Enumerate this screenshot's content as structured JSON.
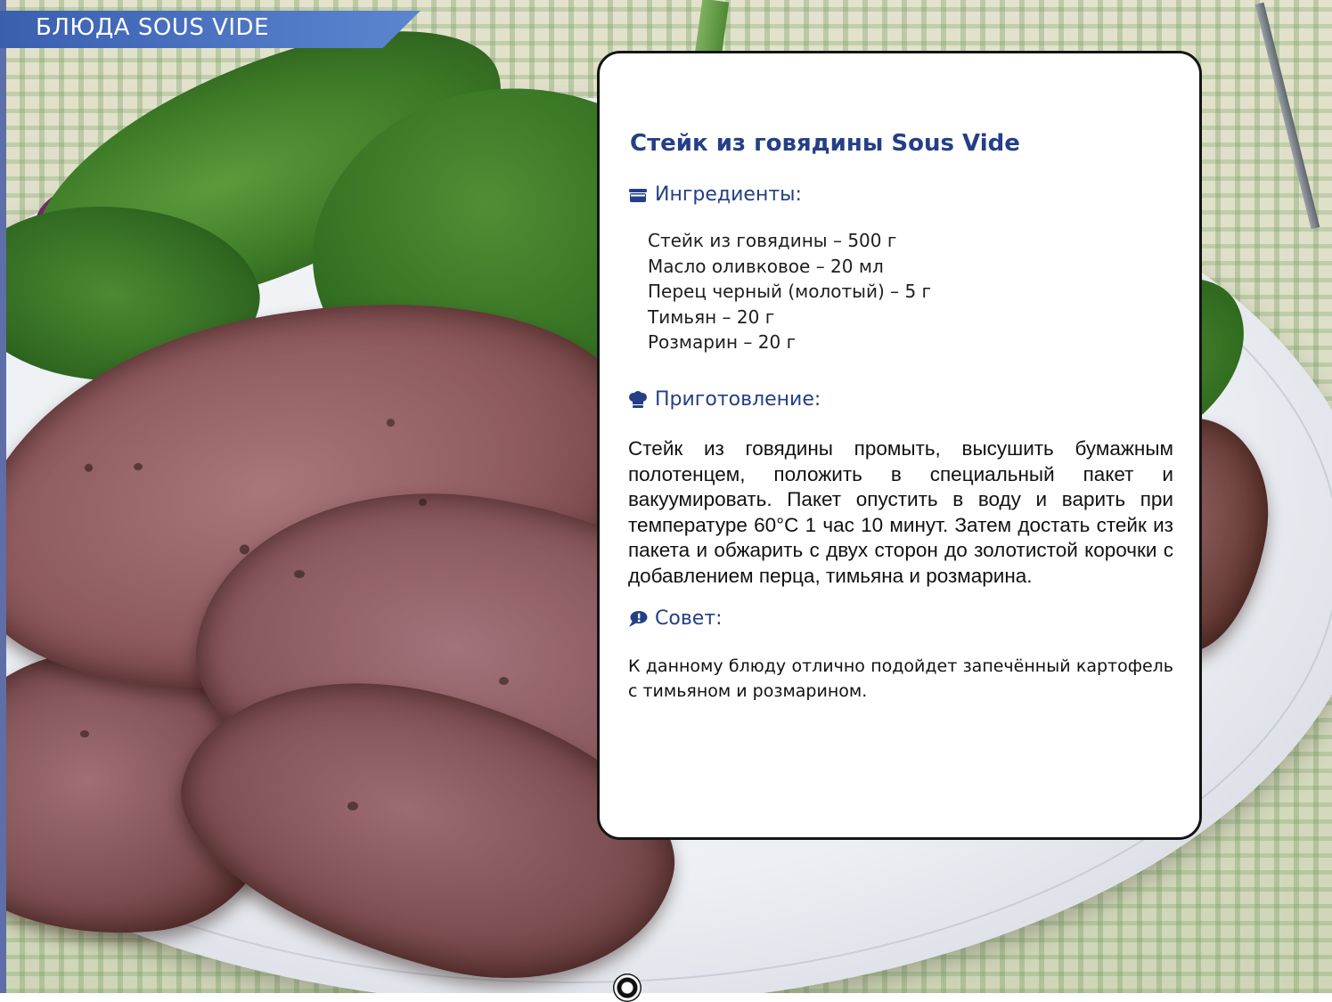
{
  "section_tab": {
    "label": "БЛЮДА SOUS VIDE"
  },
  "recipe": {
    "title": "Стейк из говядины Sous Vide",
    "ingredients_heading": "Ингредиенты:",
    "ingredients": [
      "Стейк из говядины – 500 г",
      "Масло оливковое – 20 мл",
      "Перец черный (молотый) – 5 г",
      "Тимьян – 20 г",
      "Розмарин – 20 г"
    ],
    "preparation_heading": "Приготовление:",
    "preparation_text": "Стейк из говядины промыть, высушить бумажным полотенцем, положить в специальный пакет и вакуумировать. Пакет опустить в воду и варить при температуре 60°С 1 час 10 минут. Затем достать стейк из пакета и обжарить с двух сторон до золотистой корочки с добавлением перца, тимьяна и розмарина.",
    "tip_heading": "Совет:",
    "tip_text": "К данному блюду отлично подойдет запечённый картофель с тимьяном и розмарином."
  },
  "icons": {
    "ingredients": "pot-icon",
    "preparation": "chef-hat-icon",
    "tip": "speech-bubble-icon"
  },
  "colors": {
    "accent": "#243f86",
    "tab_start": "#3a5fb0",
    "tab_end": "#5b86cf",
    "card_border": "#151515"
  }
}
